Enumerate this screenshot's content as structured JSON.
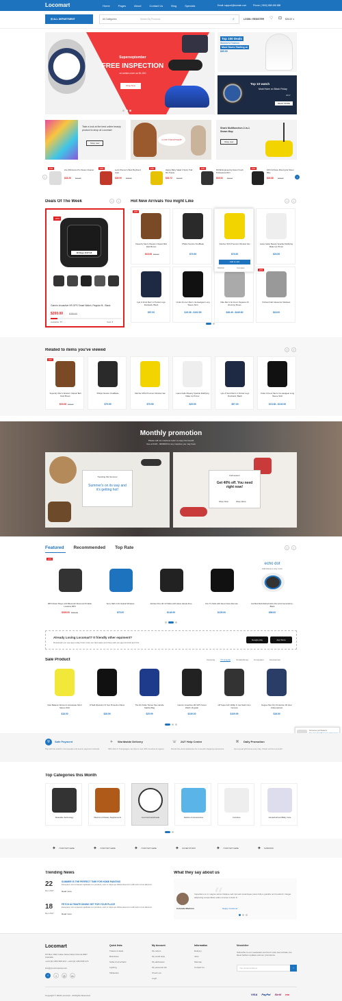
{
  "header": {
    "logo": "Locomart",
    "nav": [
      "Home",
      "Pages",
      "About",
      "Contact Us",
      "Blog",
      "Specials"
    ],
    "email": "Email: support@domain.com",
    "phone": "Phone: (+800) 888 456 888",
    "dept": "ALL DEPARTMENT",
    "cat": "All Categories",
    "search_ph": "Search By Products",
    "login": "LOGIN / REGISTER",
    "cart": "$26.00 ∨"
  },
  "hero": {
    "small": "Superseptember",
    "title": "FREE INSPECTION",
    "sub": "on orders over us $1,000",
    "btn": "Shop Now"
  },
  "side1": {
    "title": "Top 100 Deals",
    "l1": "Women's Fashion",
    "l2": "Must Haves Starting at",
    "price": "$65.99"
  },
  "side2": {
    "t1": "Top 10 watch",
    "t2": "Must Have on Black Friday",
    "year": "2017",
    "btn": "READ MORE"
  },
  "promo": [
    {
      "t": "Take a look at the best online beauty product to shop at Locomart",
      "btn": "Shop now"
    },
    {
      "t": "Love Handmade"
    },
    {
      "t": "Shark Multifunction 2-in-1 Steam Mop",
      "btn": "Shop now"
    }
  ],
  "strip": [
    {
      "name": "Zoo 360-Home Pro Steam Cleaner",
      "p": "$18.26",
      "o": "$24.35",
      "b": "-15%"
    },
    {
      "name": "Levis Women's Best Boyfriend Jean",
      "p": "$28.99",
      "o": "$35.00",
      "b": "-15%"
    },
    {
      "name": "Happy Baby Salad 4 Spicy Trail Mix Purple",
      "p": "$18.72",
      "o": "$27.00",
      "b": "-15%"
    },
    {
      "name": "RUSE Engineering Super Fresh Professional Dirt",
      "p": "$19.53",
      "o": "$24.11",
      "b": "-15%"
    },
    {
      "name": "106 Full Face Motorcycle Street Bike",
      "p": "$24.88",
      "o": "$18.00",
      "b": "-15%"
    }
  ],
  "deals": {
    "title": "Deals Of The Week",
    "badge": "-20%",
    "name": "Garmin vivoactive HR GPS Smart Watch, Regular fit - Black",
    "price": "$200.00",
    "old": "$250.00",
    "avail": "Available: 87",
    "sold": "Sold: 8",
    "days": "32 Days 8:07:18"
  },
  "arrivals": {
    "title": "Hot New Arrivals You might Like",
    "items": [
      {
        "n": "Superdry Men's Western Classic Belt Dark Brown",
        "p": "$15.08",
        "o": "$26.00",
        "b": "-20%"
      },
      {
        "n": "Philips Norelco OneBlade",
        "p": "$79.99"
      },
      {
        "n": "Kärcher WV2 Premium Window Vac",
        "p": "$75.59",
        "btn": "Add to cart",
        "w": "Wishlist",
        "c": "Compare"
      },
      {
        "n": "Laura Geller Beauty Spackle Multifying Make Up Primer",
        "p": "$25.59"
      },
      {
        "n": "Lyle & Scott Men's 2 Pocket Logo Rucksack, Black",
        "p": "$57.00"
      },
      {
        "n": "Under Armour Men's Ua Heatgear Long Sleeve Shirt",
        "p": "$15.38 - $102.99"
      },
      {
        "n": "Nike Men's Air Zoom Pegasus 33 Running Shoes",
        "p": "$48.49 - $449.80"
      },
      {
        "n": "KitchenCraft Casserole Stainless",
        "p": "$18.00",
        "b": "-20%"
      }
    ]
  },
  "related": {
    "title": "Related to items you've viewed",
    "items": [
      {
        "n": "Superdry Men's Western Classic Belt Dark Brown",
        "p": "$15.08",
        "o": "$26.00",
        "b": "-20%"
      },
      {
        "n": "Philips Norelco OneBlade",
        "p": "$79.99"
      },
      {
        "n": "Kärcher WV2 Premium Window Vac",
        "p": "$75.59"
      },
      {
        "n": "Laura Geller Beauty Spackle Multifying Make Up Primer",
        "p": "$25.59"
      },
      {
        "n": "Lyle & Scott Men's 2 Pocket Logo Rucksack, Black",
        "p": "$57.00"
      },
      {
        "n": "Under Armour Men's Ua Heatgear Long Sleeve Shirt",
        "p": "$15.38 - $102.99"
      }
    ]
  },
  "monthly": {
    "title": "Monthly promotion",
    "sub": "Please call our customer team to enjoy the benefit",
    "line2": "Use at 0123 - 0000000 for any inquiries you may have",
    "c1": {
      "top": "Trending this Summer",
      "text": "Summer's on its way and it's getting hot!"
    },
    "c2": {
      "top": "Fall season",
      "text": "Get 40% off. You need right now!",
      "b1": "Shop Now",
      "b2": "Shop More"
    }
  },
  "featured": {
    "tabs": [
      "Featured",
      "Recommended",
      "Top Rate"
    ],
    "items": [
      {
        "n": "MP3 Music Player with Bluetooth Diamond Portable Lossless MP3",
        "p": "$300.00",
        "o": "$360.00",
        "b": "-20%"
      },
      {
        "n": "Sony NEX 2.4G Optical Wireless",
        "p": "$75.00"
      },
      {
        "n": "All-New Fire HD 10 Tablet with Alexa Hands-Free",
        "p": "$149.99"
      },
      {
        "n": "Fire TV Stick with Alexa Voice Remote",
        "p": "$125.00"
      },
      {
        "n": "Certified Refurbished Echo Dot (2nd Generation) - Black",
        "p": "$98.00",
        "logo": "echo dot",
        "sub": "Add Alexa to any room"
      }
    ]
  },
  "app": {
    "title": "Already Loving Locomart? It friendly other equiment?",
    "sub": "Download our new app today! Dont miss our fast sales and shop with our app Android and iOs.",
    "g": "Google play",
    "a": "App Store"
  },
  "sale": {
    "title": "Sale Product",
    "tabs": [
      "Cameras",
      "TV & Audio",
      "Smartphones",
      "Computers",
      "Accessories"
    ],
    "items": [
      {
        "n": "New Balance Women's Accelerate Short Sleeve Shirt",
        "p": "$18.00"
      },
      {
        "n": "O'Neill Wetsuits UV Sun Protection Mens",
        "p": "$28.99"
      },
      {
        "n": "The Fix Petite Teresa Tote Handle Satchel Bag",
        "p": "$25.99"
      },
      {
        "n": "Garmin vivoactive HR GPS Smart Watch, Regular",
        "p": "$249.00"
      },
      {
        "n": "HP Super HD 1296p In Car Dash Cam Camera",
        "p": "$109.99"
      },
      {
        "n": "Degree Men Dry Protection 48 Hour Antiperspirant",
        "p": "$18.00"
      }
    ]
  },
  "notify": {
    "t": "Someone purchased a",
    "n": "Fila Columbia Bled Casual Sneakers",
    "time": "10 minutes ago"
  },
  "services": [
    {
      "t": "Safe Payment",
      "d": "Pay with the world's most popular and secure payment methods."
    },
    {
      "t": "Worldwide Delivery",
      "d": "With sites in 5 languages, we ship to over 200 countries & regions."
    },
    {
      "t": "24/7 Help Center",
      "d": "Round-the-clock assistance for a smooth shopping experience."
    },
    {
      "t": "Daily Promotion",
      "d": "Get a great gift bonus every day. Check out the Locomart"
    }
  ],
  "topcats": {
    "title": "Top Categories this Month",
    "items": [
      "Wearable Technology",
      "Vitamins & Dietary Supplements",
      "Locomart Handmade",
      "Fashion & Accessories",
      "Furniture",
      "Household and Baby Care"
    ]
  },
  "brands": [
    "YOUR TEXT HERE",
    "YOUR TEXT HERE",
    "YOUR TEXT HERE",
    "OLIVER STUDIO",
    "YOUR TEXT HERE",
    "SUNDOWN"
  ],
  "news": {
    "title": "Trending News",
    "items": [
      {
        "d": "22",
        "m": "Dec 2017",
        "t": "SUMMER IS THE PERFECT TIME FOR HOME PAINTING",
        "x": "Excepteur sint occaecat cupidatat non proident, sunt in culpa qui officia deserunt mollit anim id est laborum.",
        "r": "Read more"
      },
      {
        "d": "18",
        "m": "Dec 2017",
        "t": "FETCH ULTIMATE DINING SET FOR YOUR PLACE",
        "x": "Excepteur sint occaecat cupidatat non proident, sunt in culpa qui officia deserunt mollit anim id est laborum.",
        "r": "Read more"
      }
    ]
  },
  "testimonial": {
    "title": "What they say about us",
    "text": "Imperdiet a in in magna varius tristique sed nisi sed scelerisque purus felis a gravida non hendrerit. Integer adipiscing suspendisse tellus sit amet a dolor in.",
    "name": "Colonale Machinn",
    "role": "Happy Customer"
  },
  "footer": {
    "logo": "Locomart",
    "addr": "PO Box 1622 Colles Street West Victoria 8007 Australia",
    "phone": "+144 (0) 1354 565 321 / +144 (0) 1354 565 372",
    "email": "info@yourcompany.com",
    "c1": {
      "h": "Quick links",
      "items": [
        "Tickets & deals",
        "Brandnew",
        "Sofas & armchairs",
        "Lighting",
        "Tableware"
      ]
    },
    "c2": {
      "h": "My Account",
      "items": [
        "My orders",
        "My credit slips",
        "My addresses",
        "My personal info",
        "Check out",
        "Login"
      ]
    },
    "c3": {
      "h": "Information",
      "items": [
        "Delivery",
        "Jobs",
        "Sitemap",
        "Contact Us"
      ]
    },
    "news": {
      "h": "Newsletter",
      "t": "Subscribe to our newsletters and don't miss new arrivals, the latest fashion updates and our promotions.",
      "ph": "Your Email Address"
    },
    "copy": "Copyright © 2018 Locomart - All Rights Reserved",
    "pay": [
      "VISA",
      "PayPal",
      "Skrill",
      "mc"
    ]
  },
  "colors": {
    "primary": "#1e73be",
    "sale": "#e02020",
    "hero": "#ef3b3b"
  }
}
